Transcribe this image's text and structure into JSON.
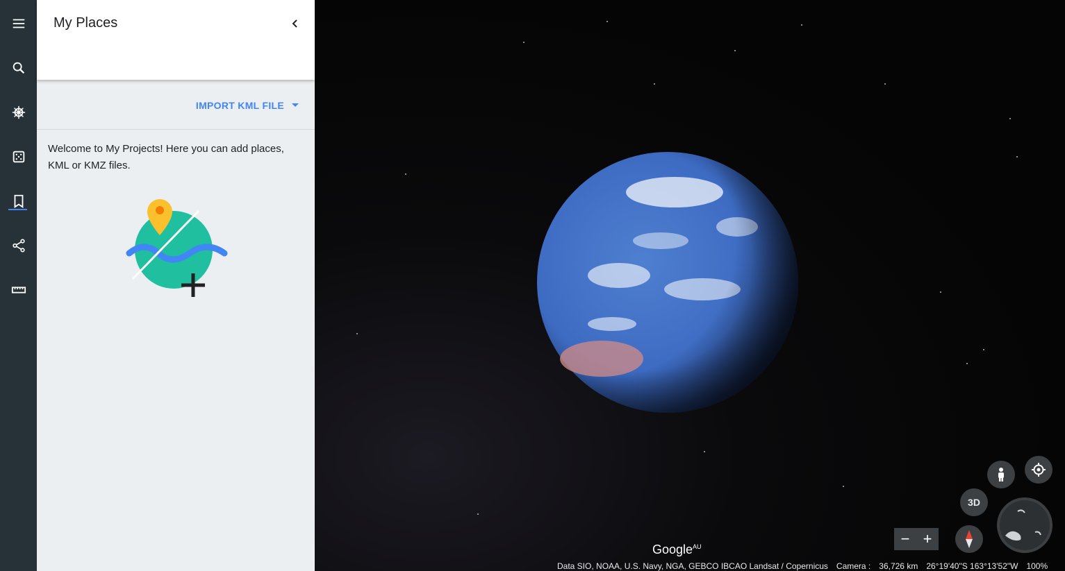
{
  "sidebar": {
    "items": [
      {
        "name": "menu",
        "icon": "menu-icon"
      },
      {
        "name": "search",
        "icon": "search-icon"
      },
      {
        "name": "voyager",
        "icon": "ships-wheel-icon"
      },
      {
        "name": "feeling-lucky",
        "icon": "dice-icon"
      },
      {
        "name": "projects",
        "icon": "bookmark-icon",
        "active": true
      },
      {
        "name": "share",
        "icon": "share-icon"
      },
      {
        "name": "measure",
        "icon": "ruler-icon"
      }
    ]
  },
  "panel": {
    "title": "My Places",
    "import_label": "IMPORT KML FILE",
    "welcome": "Welcome to My Projects! Here you can add places, KML or KMZ files."
  },
  "map": {
    "logo": "Google",
    "logo_region": "AU",
    "three_d_label": "3D",
    "zoom_out": "−",
    "zoom_in": "+",
    "attribution": "Data SIO, NOAA, U.S. Navy, NGA, GEBCO IBCAO Landsat / Copernicus",
    "camera_label": "Camera :",
    "camera_distance": "36,726 km",
    "coordinates": "26°19'40\"S 163°13'52\"W",
    "zoom_percent": "100%"
  },
  "colors": {
    "accent": "#4285f4",
    "rail_bg": "#263238",
    "panel_bg": "#eceff1"
  }
}
